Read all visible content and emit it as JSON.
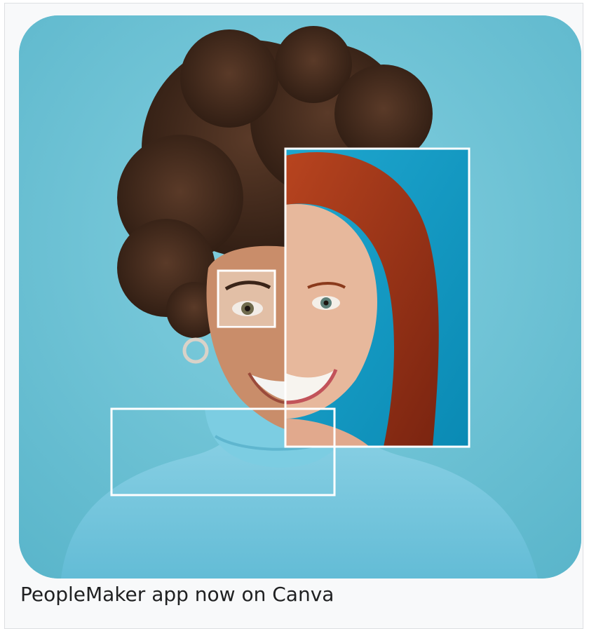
{
  "caption": "PeopleMaker app now on Canva",
  "image": {
    "alt": "PeopleMaker app now on Canva",
    "background_color": "#6fc3d6",
    "frame_color": "#ffffff"
  }
}
